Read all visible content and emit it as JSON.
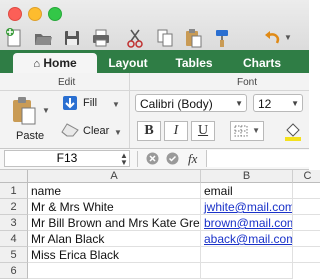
{
  "window": {
    "buttons": [
      "close",
      "minimize",
      "zoom"
    ]
  },
  "toolbar": {
    "icons": [
      "new-icon",
      "open-icon",
      "save-icon",
      "print-icon",
      "cut-icon",
      "copy-icon",
      "paste-icon",
      "format-painter-icon",
      "undo-icon"
    ]
  },
  "ribbon": {
    "tabs": [
      {
        "label": "Home",
        "active": true
      },
      {
        "label": "Layout",
        "active": false
      },
      {
        "label": "Tables",
        "active": false
      },
      {
        "label": "Charts",
        "active": false
      }
    ],
    "edit_group": {
      "label": "Edit",
      "paste": "Paste",
      "fill": "Fill",
      "clear": "Clear"
    },
    "font_group": {
      "label": "Font",
      "font_name": "Calibri (Body)",
      "font_size": "12",
      "bold": "B",
      "italic": "I",
      "underline": "U"
    }
  },
  "formula_bar": {
    "name_box": "F13",
    "fx": "fx",
    "value": ""
  },
  "sheet": {
    "columns": [
      "A",
      "B",
      "C"
    ],
    "rows": [
      {
        "num": "1",
        "a": "name",
        "b": "email"
      },
      {
        "num": "2",
        "a": "Mr & Mrs White",
        "b": "jwhite@mail.com"
      },
      {
        "num": "3",
        "a": "Mr Bill Brown and Mrs Kate Green",
        "b": "brown@mail.com"
      },
      {
        "num": "4",
        "a": "Mr Alan Black",
        "b": "aback@mail.com"
      },
      {
        "num": "5",
        "a": "Miss Erica Black",
        "b": ""
      },
      {
        "num": "6",
        "a": "",
        "b": ""
      }
    ],
    "link_color": "#1a32c9"
  },
  "colors": {
    "ribbon_tab_bar": "#2f7d45"
  }
}
